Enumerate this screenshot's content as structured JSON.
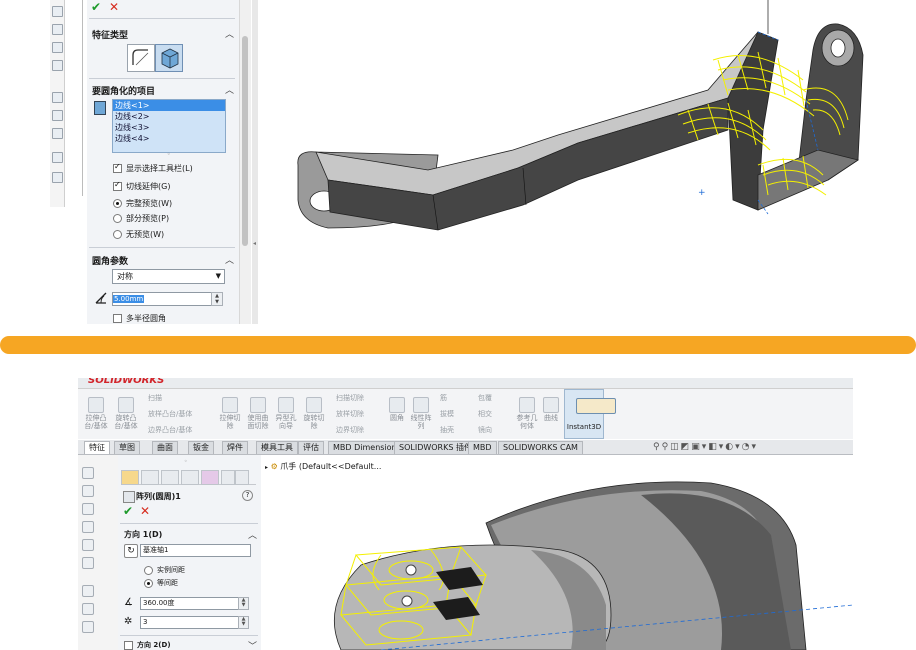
{
  "top": {
    "panel": {
      "ok_icon": "checkmark-icon",
      "cancel_icon": "cross-icon",
      "feature_type_title": "特征类型",
      "items_title": "要圆角化的项目",
      "edges": [
        "边线<1>",
        "边线<2>",
        "边线<3>",
        "边线<4>"
      ],
      "show_toolbar": "显示选择工具栏(L)",
      "tangent_prop": "切线延伸(G)",
      "full_preview": "完整预览(W)",
      "partial_preview": "部分预览(P)",
      "no_preview": "无预览(W)",
      "params_title": "圆角参数",
      "symmetric": "对称",
      "radius": "5.00mm",
      "multi_radius": "多半径圆角"
    },
    "accent": "#f4f000"
  },
  "divider_color": "#f6a623",
  "bottom": {
    "app_logo": "SOLIDWORKS",
    "ribbon": {
      "btn1": "拉伸凸\n台/基体",
      "btn2": "旋转凸\n台/基体",
      "sweep": "扫描",
      "loft": "放样凸台/基体",
      "boundary": "边界凸台/基体",
      "btn3": "拉伸切\n除",
      "btn4": "异型孔\n向导",
      "btn5": "旋转切\n除",
      "sweep_cut": "扫描切除",
      "loft_cut": "放样切除",
      "boundary_cut": "边界切除",
      "fillet": "圆角",
      "linear_pattern": "线性阵\n列",
      "rib": "筋",
      "draft": "拔模",
      "shell": "抽壳",
      "wrap": "包覆",
      "intersect": "相交",
      "mirror": "镜向",
      "ref_geom": "参考几\n何体",
      "curves": "曲线",
      "instant3d": "Instant3D",
      "used_cut": "使用曲\n面切除"
    },
    "tabs": [
      "特征",
      "草图",
      "曲面",
      "钣金",
      "焊件",
      "模具工具",
      "评估",
      "MBD Dimensions",
      "SOLIDWORKS 插件",
      "MBD",
      "SOLIDWORKS CAM"
    ],
    "tree_root": "爪手 (Default<<Default...",
    "panel": {
      "title": "阵列(圆周)1",
      "help": "?",
      "dir1_title": "方向 1(D)",
      "axis": "基准轴1",
      "instance_spacing": "实例间距",
      "equal_spacing": "等间距",
      "angle": "360.00度",
      "count": "3",
      "dir2_title": "方向 2(D)"
    }
  }
}
